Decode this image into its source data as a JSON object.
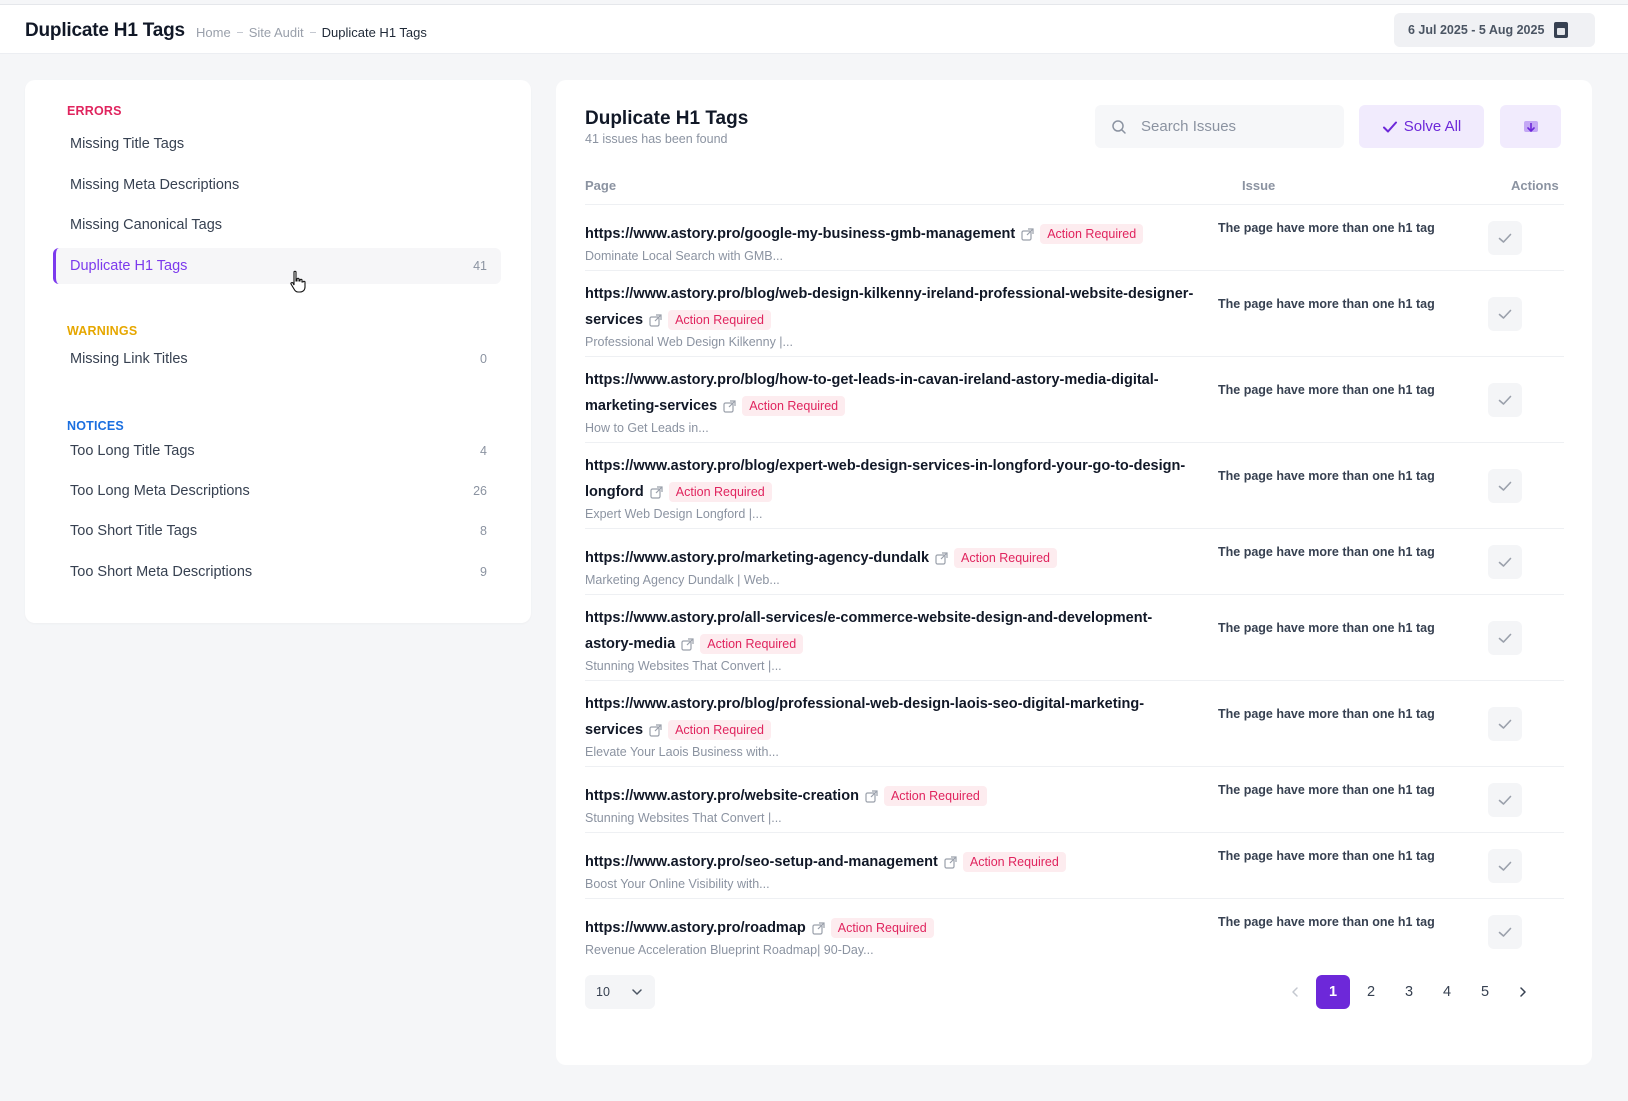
{
  "header": {
    "title": "Duplicate H1 Tags",
    "breadcrumb": [
      "Home",
      "Site Audit",
      "Duplicate H1 Tags"
    ],
    "date_range": "6 Jul 2025 - 5 Aug 2025"
  },
  "sidebar": {
    "errors_label": "ERRORS",
    "warnings_label": "WARNINGS",
    "notices_label": "NOTICES",
    "errors": [
      {
        "label": "Missing Title Tags",
        "count": ""
      },
      {
        "label": "Missing Meta Descriptions",
        "count": ""
      },
      {
        "label": "Missing Canonical Tags",
        "count": ""
      },
      {
        "label": "Duplicate H1 Tags",
        "count": "41",
        "active": true
      }
    ],
    "warnings": [
      {
        "label": "Missing Link Titles",
        "count": "0"
      }
    ],
    "notices": [
      {
        "label": "Too Long Title Tags",
        "count": "4"
      },
      {
        "label": "Too Long Meta Descriptions",
        "count": "26"
      },
      {
        "label": "Too Short Title Tags",
        "count": "8"
      },
      {
        "label": "Too Short Meta Descriptions",
        "count": "9"
      }
    ]
  },
  "main": {
    "title": "Duplicate H1 Tags",
    "subtitle": "41 issues has been found",
    "search_placeholder": "Search Issues",
    "solve_all_label": "Solve All",
    "columns": {
      "page": "Page",
      "issue": "Issue",
      "actions": "Actions"
    },
    "rows": [
      {
        "url": "https://www.astory.pro/google-my-business-gmb-management",
        "badge": "Action Required",
        "desc": "Dominate Local Search with GMB...",
        "issue": "The page have more than one h1 tag"
      },
      {
        "url": "https://www.astory.pro/blog/web-design-kilkenny-ireland-professional-website-designer-services",
        "badge": "Action Required",
        "desc": "Professional Web Design Kilkenny |...",
        "issue": "The page have more than one h1 tag"
      },
      {
        "url": "https://www.astory.pro/blog/how-to-get-leads-in-cavan-ireland-astory-media-digital-marketing-services",
        "badge": "Action Required",
        "desc": "How to Get Leads in...",
        "issue": "The page have more than one h1 tag"
      },
      {
        "url": "https://www.astory.pro/blog/expert-web-design-services-in-longford-your-go-to-design-longford",
        "badge": "Action Required",
        "desc": "Expert Web Design Longford |...",
        "issue": "The page have more than one h1 tag"
      },
      {
        "url": "https://www.astory.pro/marketing-agency-dundalk",
        "badge": "Action Required",
        "desc": "Marketing Agency Dundalk | Web...",
        "issue": "The page have more than one h1 tag"
      },
      {
        "url": "https://www.astory.pro/all-services/e-commerce-website-design-and-development-astory-media",
        "badge": "Action Required",
        "desc": "Stunning Websites That Convert |...",
        "issue": "The page have more than one h1 tag"
      },
      {
        "url": "https://www.astory.pro/blog/professional-web-design-laois-seo-digital-marketing-services",
        "badge": "Action Required",
        "desc": "Elevate Your Laois Business with...",
        "issue": "The page have more than one h1 tag"
      },
      {
        "url": "https://www.astory.pro/website-creation",
        "badge": "Action Required",
        "desc": "Stunning Websites That Convert |...",
        "issue": "The page have more than one h1 tag"
      },
      {
        "url": "https://www.astory.pro/seo-setup-and-management",
        "badge": "Action Required",
        "desc": "Boost Your Online Visibility with...",
        "issue": "The page have more than one h1 tag"
      },
      {
        "url": "https://www.astory.pro/roadmap",
        "badge": "Action Required",
        "desc": "Revenue Acceleration Blueprint Roadmap| 90-Day...",
        "issue": "The page have more than one h1 tag"
      }
    ],
    "per_page": "10",
    "pages": [
      "1",
      "2",
      "3",
      "4",
      "5"
    ],
    "current_page": "1"
  },
  "colors": {
    "accent": "#6d28d9",
    "error": "#e0245e",
    "warning": "#e6a700",
    "notice": "#1b6fe0"
  }
}
